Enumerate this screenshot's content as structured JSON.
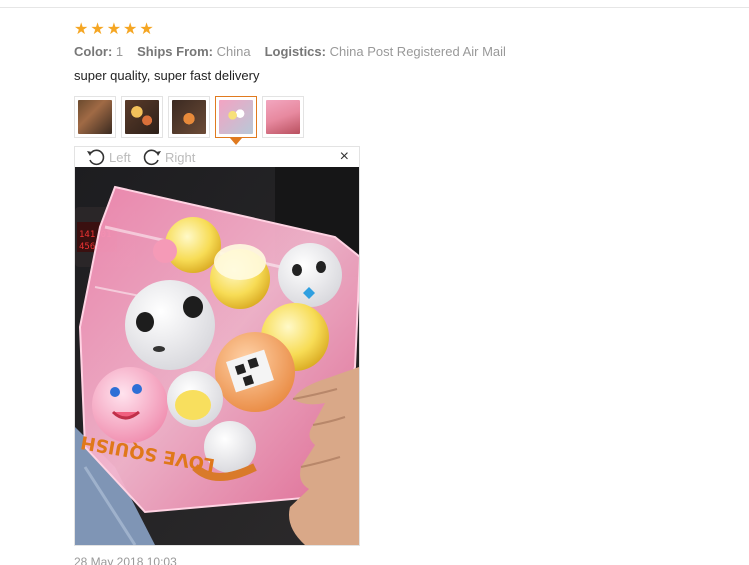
{
  "review": {
    "stars": [
      "★",
      "★",
      "★",
      "★",
      "★"
    ],
    "color_label": "Color:",
    "color_value": "1",
    "ships_label": "Ships From:",
    "ships_value": "China",
    "logistics_label": "Logistics:",
    "logistics_value": "China Post Registered Air Mail",
    "text": "super quality, super fast delivery",
    "date": "28 May 2018 10:03"
  },
  "viewer": {
    "rotate_left_label": "Left",
    "rotate_right_label": "Right",
    "close_glyph": "×",
    "photo_bag_text": "LOVE SQUISH",
    "thumbnail_count": 5,
    "active_thumbnail": 4
  },
  "colors": {
    "star": "#f5a623",
    "active_thumb_border": "#e07a1f",
    "bag_pink": "#f07aa5"
  }
}
